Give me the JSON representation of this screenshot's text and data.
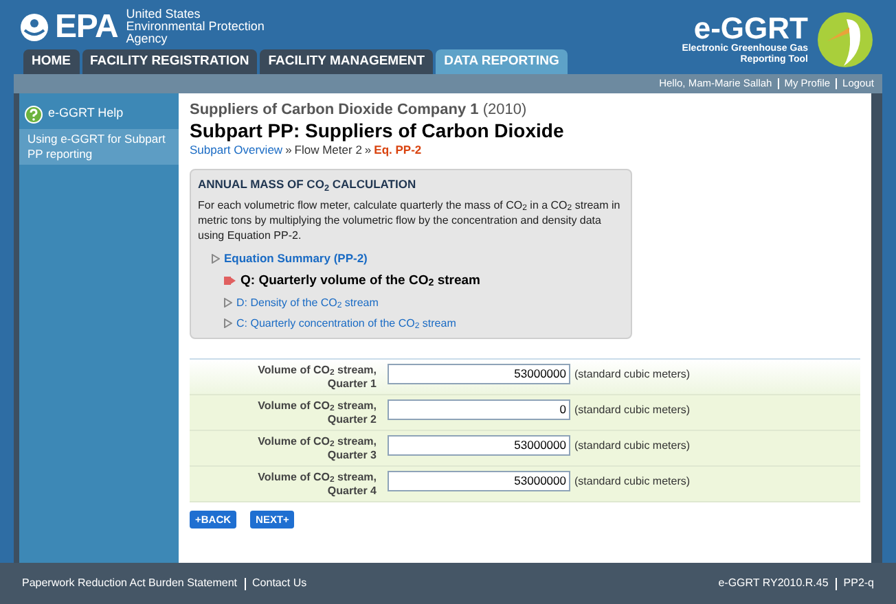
{
  "header": {
    "agency_lines": [
      "United States",
      "Environmental Protection",
      "Agency"
    ],
    "logo_text": "EPA",
    "tool_logo": "e-GGRT",
    "tool_name_lines": [
      "Electronic Greenhouse Gas",
      "Reporting Tool"
    ]
  },
  "tabs": [
    {
      "label": "HOME",
      "selected": false
    },
    {
      "label": "FACILITY REGISTRATION",
      "selected": false
    },
    {
      "label": "FACILITY MANAGEMENT",
      "selected": false
    },
    {
      "label": "DATA REPORTING",
      "selected": true
    }
  ],
  "user_links": [
    "Hello, Mam-Marie Sallah",
    "My Profile",
    "Logout"
  ],
  "sidebar": {
    "help": "e-GGRT Help",
    "items": [
      {
        "label": "Using e-GGRT for Subpart PP reporting",
        "selected": true
      }
    ]
  },
  "page": {
    "company": "Suppliers of Carbon Dioxide Company 1",
    "year": "(2010)",
    "title": "Subpart PP: Suppliers of Carbon Dioxide",
    "breadcrumb": [
      {
        "label": "Subpart Overview",
        "kind": "link"
      },
      {
        "label": "»",
        "kind": "separator"
      },
      {
        "label": "Flow Meter 2",
        "kind": "plain"
      },
      {
        "label": "»",
        "kind": "separator"
      },
      {
        "label": "Eq. PP-2",
        "kind": "current"
      }
    ]
  },
  "info_box": {
    "title": "ANNUAL MASS OF CO$_{2}$ CALCULATION",
    "text": "For each volumetric flow meter, calculate quarterly the mass of CO$_{2}$ in a CO$_{2}$ stream in metric tons by multiplying the volumetric flow by the concentration and density data using Equation PP-2.",
    "summary": "Equation Summary (PP-2)",
    "equations": [
      {
        "label": "Q: Quarterly volume of the CO$_{2}$ stream",
        "selected": true
      },
      {
        "label": "D: Density of the CO$_{2}$ stream",
        "selected": false
      },
      {
        "label": "C: Quarterly concentration of the CO$_{2}$ stream",
        "selected": false
      }
    ]
  },
  "form_rows": [
    {
      "label_lines": [
        "Volume of CO$_{2}$ stream,",
        "Quarter 1"
      ],
      "value": "53000000",
      "unit": "(standard cubic meters)"
    },
    {
      "label_lines": [
        "Volume of CO$_{2}$ stream,",
        "Quarter 2"
      ],
      "value": "0",
      "unit": "(standard cubic meters)"
    },
    {
      "label_lines": [
        "Volume of CO$_{2}$ stream,",
        "Quarter 3"
      ],
      "value": "53000000",
      "unit": "(standard cubic meters)"
    },
    {
      "label_lines": [
        "Volume of CO$_{2}$ stream,",
        "Quarter 4"
      ],
      "value": "53000000",
      "unit": "(standard cubic meters)"
    }
  ],
  "buttons": [
    "+BACK",
    "NEXT+"
  ],
  "footer": {
    "left": [
      "Paperwork Reduction Act Burden Statement",
      "Contact Us"
    ],
    "right": [
      "e-GGRT RY2010.R.45",
      "PP2-q"
    ]
  }
}
